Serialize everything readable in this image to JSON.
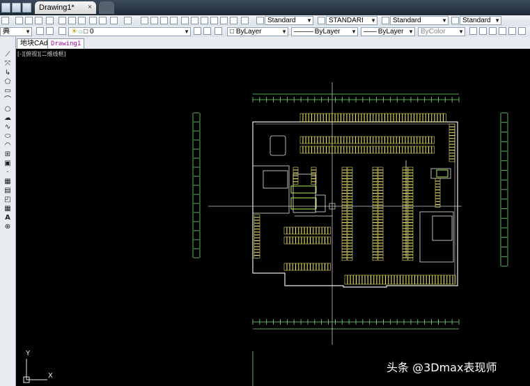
{
  "document_tab": {
    "title": "Drawing1*",
    "close": "×"
  },
  "toolbar1": {
    "text_style": "Standard",
    "dim_style": "STANDARI",
    "table_style": "Standard",
    "mleader_style": "Standard"
  },
  "toolbar2": {
    "workspace": "典",
    "layer_value": "0",
    "color": "ByLayer",
    "linetype": "ByLayer",
    "lineweight": "ByLayer",
    "plotstyle": "ByColor"
  },
  "file_tabs": [
    "地块CAd",
    "Drawing1"
  ],
  "viewport_label": "[-][俯视][二维线框]",
  "ucs": {
    "y": "Y",
    "x": "X"
  },
  "watermark": "头条 @3Dmax表现师",
  "colors": {
    "cad_green": "#7be07b",
    "cad_yellow": "#e6e066",
    "cad_white": "#e8e8e8"
  }
}
